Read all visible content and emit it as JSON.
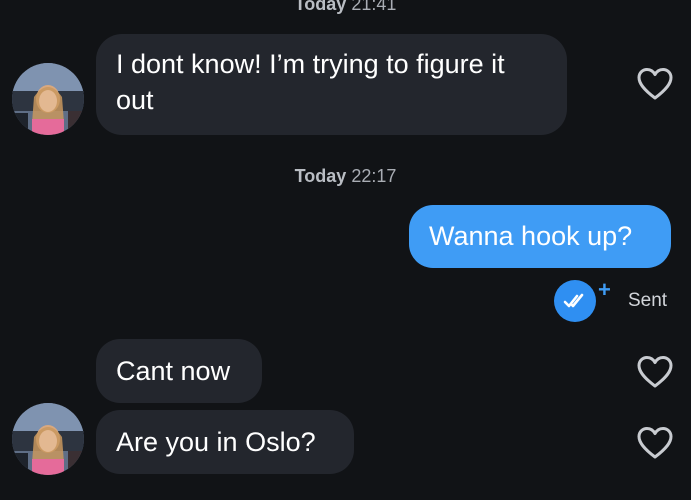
{
  "timestamps": [
    {
      "day": "Today",
      "time": "21:41"
    },
    {
      "day": "Today",
      "time": "22:17"
    }
  ],
  "messages": [
    {
      "direction": "incoming",
      "text": "I dont know! I’m trying to figure it out"
    },
    {
      "direction": "outgoing",
      "text": "Wanna hook up?"
    },
    {
      "direction": "incoming",
      "text": "Cant now"
    },
    {
      "direction": "incoming",
      "text": "Are you in Oslo?"
    }
  ],
  "status": {
    "label": "Sent",
    "plus": "+"
  },
  "icons": {
    "like": "heart-outline-icon",
    "receipt": "double-check-icon",
    "avatar": "contact-photo"
  },
  "colors": {
    "background": "#111316",
    "incoming_bubble": "#23262d",
    "outgoing_bubble": "#3f9cf5",
    "accent": "#2f8ff2"
  }
}
